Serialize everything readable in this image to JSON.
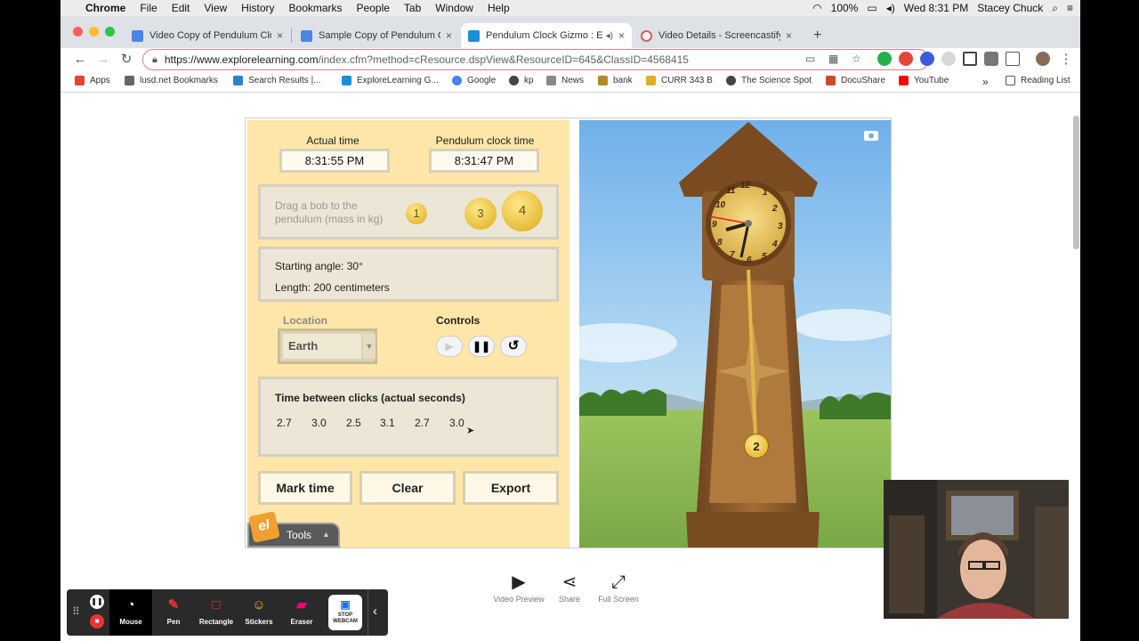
{
  "menubar": {
    "app": "Chrome",
    "items": [
      "File",
      "Edit",
      "View",
      "History",
      "Bookmarks",
      "People",
      "Tab",
      "Window",
      "Help"
    ],
    "battery": "100%",
    "clock": "Wed 8:31 PM",
    "user": "Stacey Chuck"
  },
  "tabs": [
    {
      "label": "Video Copy of Pendulum Clock",
      "close": "×"
    },
    {
      "label": "Sample Copy of Pendulum Clock",
      "close": "×"
    },
    {
      "label": "Pendulum Clock Gizmo : E",
      "close": "×"
    },
    {
      "label": "Video Details - Screencastify",
      "close": "×"
    }
  ],
  "new_tab": "+",
  "address": {
    "url_host": "https://www.explorelearning.com",
    "url_path": "/index.cfm?method=cResource.dspView&ResourceID=645&ClassID=4568415"
  },
  "bookmarks": {
    "items": [
      "Apps",
      "lusd.net Bookmarks",
      "Search Results |...",
      "ExploreLearning G...",
      "Google",
      "kp",
      "News",
      "bank",
      "CURR 343 B",
      "The Science Spot",
      "DocuShare",
      "YouTube"
    ],
    "more": "»",
    "reading_list": "Reading List"
  },
  "gizmo": {
    "actual_time_label": "Actual time",
    "actual_time": "8:31:55 PM",
    "pendulum_time_label": "Pendulum clock time",
    "pendulum_time": "8:31:47 PM",
    "drag_prompt": "Drag a bob to the pendulum (mass in kg)",
    "bobs": [
      "1",
      "3",
      "4"
    ],
    "starting_angle": "Starting angle: 30°",
    "length": "Length: 200 centimeters",
    "location_label": "Location",
    "location_value": "Earth",
    "controls_label": "Controls",
    "clicks_title": "Time between clicks (actual seconds)",
    "clicks": [
      "2.7",
      "3.0",
      "2.5",
      "3.1",
      "2.7",
      "3.0"
    ],
    "buttons": {
      "mark": "Mark time",
      "clear": "Clear",
      "export": "Export"
    },
    "tools": "Tools",
    "tools_logo": "el",
    "pendulum_bob": "2",
    "clock_numbers": [
      "12",
      "1",
      "2",
      "3",
      "4",
      "5",
      "6",
      "7",
      "8",
      "9",
      "10",
      "11"
    ]
  },
  "bottom_controls": {
    "video_preview": "Video Preview",
    "share": "Share",
    "full_screen": "Full Screen"
  },
  "screencastify": {
    "mouse": "Mouse",
    "pen": "Pen",
    "rectangle": "Rectangle",
    "stickers": "Stickers",
    "eraser": "Eraser",
    "stop_webcam": "STOP WEBCAM"
  },
  "colors": {
    "gizmo_panel": "#fde6a8",
    "sky": "#8fc3ef",
    "grass": "#8fbd52",
    "clock_wood": "#8a5a2b"
  }
}
